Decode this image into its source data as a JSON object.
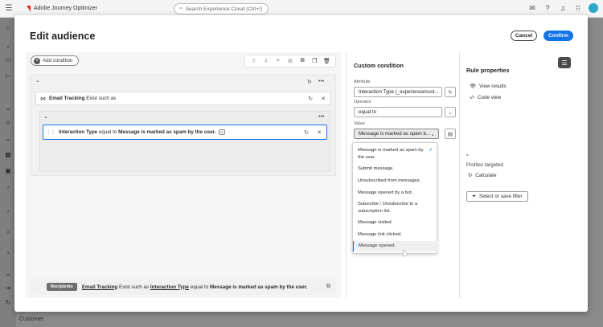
{
  "app": {
    "brand": "Adobe Journey Optimizer",
    "search_placeholder": "Search Experience Cloud (Ctrl+/)",
    "bottom_nav_label": "Customer"
  },
  "modal": {
    "title": "Edit audience",
    "cancel_label": "Cancel",
    "confirm_label": "Confirm"
  },
  "editor": {
    "add_condition_label": "Add condition",
    "rule_1": {
      "attribute": "Email Tracking",
      "text": "Exist such as"
    },
    "rule_2": {
      "attribute": "Interaction Type",
      "operator": "equal to",
      "value": "Message is marked as spam by the user.",
      "badge": "Ai"
    }
  },
  "summary": {
    "badge": "Recipients",
    "part1": "Email Tracking",
    "part2": "Exist such as",
    "part3": "Interaction Type",
    "part4": "equal to",
    "part5": "Message is marked as spam by the user."
  },
  "custom_condition": {
    "title": "Custom condition",
    "attribute_label": "Attribute",
    "attribute_value": "Interaction Type (_experience/cust...",
    "operator_label": "Operator",
    "operator_value": "equal to",
    "value_label": "Value",
    "value_value": "Message is marked as spam b...",
    "options": [
      "Message is marked as spam by the user.",
      "Submit message.",
      "Unsubscribed from messages.",
      "Message opened by a bot.",
      "Subscribe / Unsubscribe to a subscription list.",
      "Message visited.",
      "Message link clicked.",
      "Message opened."
    ],
    "selected_index": 0,
    "hover_index": 7
  },
  "rule_properties": {
    "title": "Rule properties",
    "view_results": "View results",
    "code_view": "Code view",
    "profiles_value": "-",
    "profiles_label": "Profiles targeted",
    "calculate": "Calculate",
    "select_filter": "Select or save filter"
  },
  "colors": {
    "accent": "#1473e6",
    "brand_red": "#e1251b"
  }
}
